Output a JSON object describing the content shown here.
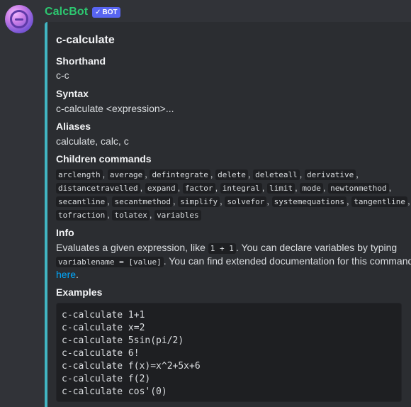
{
  "author": {
    "name": "CalcBot",
    "badge": "BOT",
    "badge_check_icon": "checkmark-icon"
  },
  "colors": {
    "accent": "#41b5c2",
    "username": "#2dc770",
    "badge": "#5865f2",
    "link": "#00a8fc"
  },
  "embed": {
    "title": "c-calculate",
    "shorthand": {
      "name": "Shorthand",
      "value": "c-c"
    },
    "syntax": {
      "name": "Syntax",
      "value": "c-calculate <expression>..."
    },
    "aliases": {
      "name": "Aliases",
      "value": "calculate, calc, c"
    },
    "children": {
      "name": "Children commands",
      "items": [
        "arclength",
        "average",
        "defintegrate",
        "delete",
        "deleteall",
        "derivative",
        "distancetravelled",
        "expand",
        "factor",
        "integral",
        "limit",
        "mode",
        "newtonmethod",
        "secantline",
        "secantmethod",
        "simplify",
        "solvefor",
        "systemequations",
        "tangentline",
        "tofraction",
        "tolatex",
        "variables"
      ]
    },
    "info": {
      "name": "Info",
      "text1": "Evaluates a given expression, like ",
      "code1": "1 + 1",
      "text2": ". You can declare variables by typing",
      "code2": "variablename = [value]",
      "text3": ". You can find extended documentation for this command",
      "link": "here",
      "text4": "."
    },
    "examples": {
      "name": "Examples",
      "lines": [
        "c-calculate 1+1",
        "c-calculate x=2",
        "c-calculate 5sin(pi/2)",
        "c-calculate 6!",
        "c-calculate f(x)=x^2+5x+6",
        "c-calculate f(2)",
        "c-calculate cos'(0)"
      ]
    }
  }
}
